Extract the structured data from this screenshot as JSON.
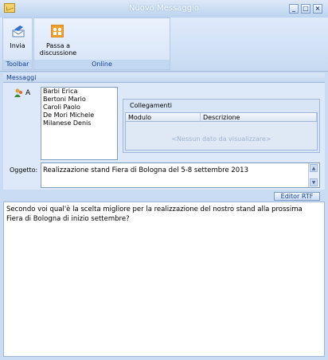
{
  "window": {
    "title": "Nuovo Messaggio"
  },
  "ribbon": {
    "toolbar_group_label": "Toolbar",
    "online_group_label": "Online",
    "send_label": "Invia",
    "discuss_label_line1": "Passa a",
    "discuss_label_line2": "discussione"
  },
  "messaggi": {
    "section_label": "Messaggi",
    "to_label": "A",
    "recipients": [
      "Barbi Erica",
      "Bertoni Mario",
      "Caroli Paolo",
      "De Mori Michele",
      "Milanese Denis"
    ],
    "links_label": "Collegamenti",
    "links_columns": [
      "Modulo",
      "Descrizione"
    ],
    "links_empty": "<Nessun dato da visualizzare>",
    "subject_label": "Oggetto:",
    "subject_value": "Realizzazione stand Fiera di Bologna del 5-8 settembre 2013"
  },
  "editor": {
    "rtf_button": "Editor RTF",
    "body_line1": "Secondo voi qual'è la scelta migliore per la realizzazione del nostro stand alla prossima",
    "body_line2": "Fiera di Bologna di inizio settembre?"
  },
  "icons": {
    "app": "envelope-icon",
    "send": "send-icon",
    "discuss": "discussion-icon",
    "to": "people-icon"
  }
}
